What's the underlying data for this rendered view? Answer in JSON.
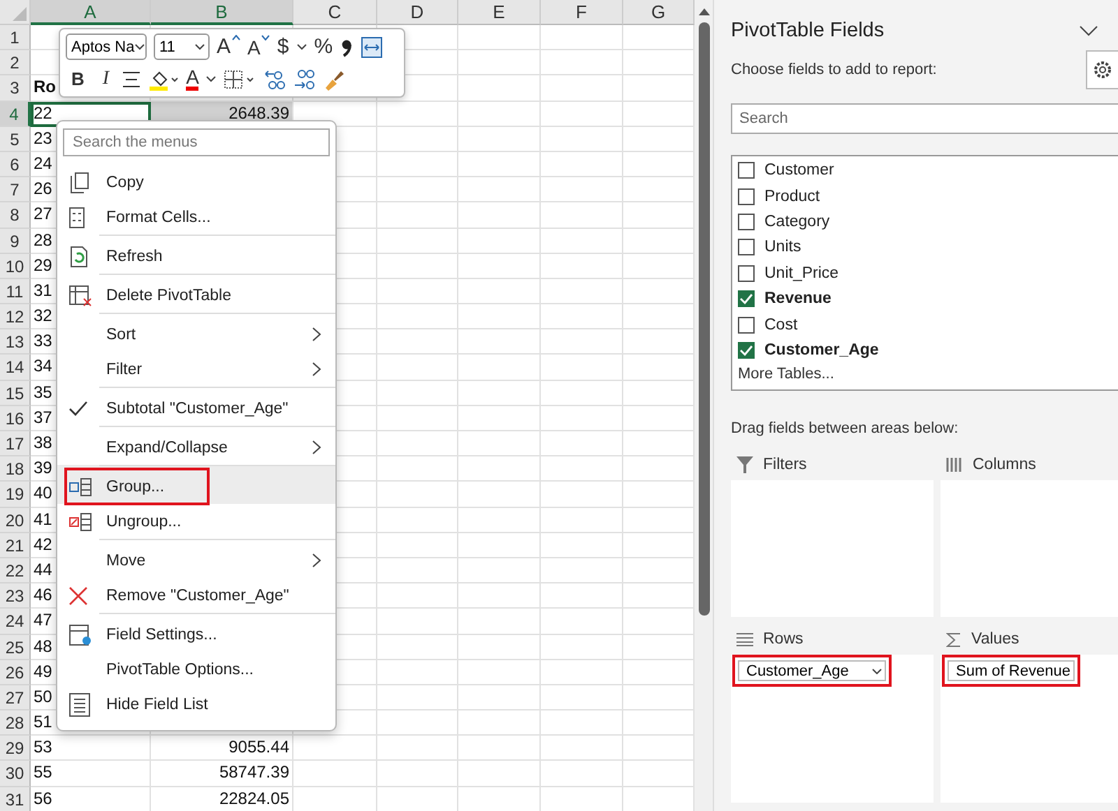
{
  "sheet": {
    "columns": [
      {
        "label": "A",
        "selected": true
      },
      {
        "label": "B",
        "selected": true
      },
      {
        "label": "C",
        "selected": false
      },
      {
        "label": "D",
        "selected": false
      },
      {
        "label": "E",
        "selected": false
      },
      {
        "label": "F",
        "selected": false
      },
      {
        "label": "G",
        "selected": false
      }
    ],
    "rows": [
      {
        "number": "1",
        "selected": false
      },
      {
        "number": "2",
        "selected": false
      },
      {
        "number": "3",
        "selected": false,
        "a": "Ro",
        "header": true
      },
      {
        "number": "4",
        "selected": true,
        "a": "22",
        "b": "2648.39"
      },
      {
        "number": "5",
        "selected": false,
        "a": "23"
      },
      {
        "number": "6",
        "selected": false,
        "a": "24"
      },
      {
        "number": "7",
        "selected": false,
        "a": "26"
      },
      {
        "number": "8",
        "selected": false,
        "a": "27"
      },
      {
        "number": "9",
        "selected": false,
        "a": "28"
      },
      {
        "number": "10",
        "selected": false,
        "a": "29"
      },
      {
        "number": "11",
        "selected": false,
        "a": "31"
      },
      {
        "number": "12",
        "selected": false,
        "a": "32"
      },
      {
        "number": "13",
        "selected": false,
        "a": "33"
      },
      {
        "number": "14",
        "selected": false,
        "a": "34"
      },
      {
        "number": "15",
        "selected": false,
        "a": "35"
      },
      {
        "number": "16",
        "selected": false,
        "a": "37"
      },
      {
        "number": "17",
        "selected": false,
        "a": "38"
      },
      {
        "number": "18",
        "selected": false,
        "a": "39"
      },
      {
        "number": "19",
        "selected": false,
        "a": "40"
      },
      {
        "number": "20",
        "selected": false,
        "a": "41"
      },
      {
        "number": "21",
        "selected": false,
        "a": "42"
      },
      {
        "number": "22",
        "selected": false,
        "a": "44"
      },
      {
        "number": "23",
        "selected": false,
        "a": "46"
      },
      {
        "number": "24",
        "selected": false,
        "a": "47"
      },
      {
        "number": "25",
        "selected": false,
        "a": "48"
      },
      {
        "number": "26",
        "selected": false,
        "a": "49"
      },
      {
        "number": "27",
        "selected": false,
        "a": "50"
      },
      {
        "number": "28",
        "selected": false,
        "a": "51"
      },
      {
        "number": "29",
        "selected": false,
        "a": "53",
        "b": "9055.44"
      },
      {
        "number": "30",
        "selected": false,
        "a": "55",
        "b": "58747.39"
      },
      {
        "number": "31",
        "selected": false,
        "a": "56",
        "b": "22824.05"
      }
    ]
  },
  "mini_toolbar": {
    "font_name": "Aptos Na",
    "font_size": "11",
    "row_1": [
      {
        "kind": "grow",
        "label": "A"
      },
      {
        "kind": "shrink",
        "label": "A"
      },
      {
        "kind": "currency",
        "label": "$"
      },
      {
        "kind": "percent",
        "label": "%"
      },
      {
        "kind": "comma"
      },
      {
        "kind": "wrap"
      }
    ],
    "row_2": [
      {
        "kind": "bold",
        "label": "B"
      },
      {
        "kind": "italic",
        "label": "I"
      },
      {
        "kind": "align"
      },
      {
        "kind": "fill"
      },
      {
        "kind": "font-color",
        "label": "A"
      },
      {
        "kind": "borders"
      },
      {
        "kind": "decrease-decimal"
      },
      {
        "kind": "increase-decimal"
      },
      {
        "kind": "format-painter"
      }
    ]
  },
  "context_menu": {
    "search": {
      "placeholder": "Search the menus"
    },
    "items": [
      {
        "label": "Copy",
        "checked": false,
        "submenu": false,
        "selected": false,
        "outlined": false,
        "separator_before": false
      },
      {
        "label": "Format Cells...",
        "checked": false,
        "submenu": false,
        "selected": false,
        "outlined": false,
        "separator_before": false
      },
      {
        "label": "Refresh",
        "checked": false,
        "submenu": false,
        "selected": false,
        "outlined": false,
        "separator_before": true
      },
      {
        "label": "Delete PivotTable",
        "checked": false,
        "submenu": false,
        "selected": false,
        "outlined": false,
        "separator_before": true
      },
      {
        "label": "Sort",
        "checked": false,
        "submenu": true,
        "selected": false,
        "outlined": false,
        "separator_before": true
      },
      {
        "label": "Filter",
        "checked": false,
        "submenu": true,
        "selected": false,
        "outlined": false,
        "separator_before": false
      },
      {
        "label": "Subtotal \"Customer_Age\"",
        "checked": true,
        "submenu": false,
        "selected": false,
        "outlined": false,
        "separator_before": true
      },
      {
        "label": "Expand/Collapse",
        "checked": false,
        "submenu": true,
        "selected": false,
        "outlined": false,
        "separator_before": true
      },
      {
        "label": "Group...",
        "checked": false,
        "submenu": false,
        "selected": true,
        "outlined": true,
        "separator_before": true
      },
      {
        "label": "Ungroup...",
        "checked": false,
        "submenu": false,
        "selected": false,
        "outlined": false,
        "separator_before": false
      },
      {
        "label": "Move",
        "checked": false,
        "submenu": true,
        "selected": false,
        "outlined": false,
        "separator_before": true
      },
      {
        "label": "Remove \"Customer_Age\"",
        "checked": false,
        "submenu": false,
        "selected": false,
        "outlined": false,
        "separator_before": false
      },
      {
        "label": "Field Settings...",
        "checked": false,
        "submenu": false,
        "selected": false,
        "outlined": false,
        "separator_before": true
      },
      {
        "label": "PivotTable Options...",
        "checked": false,
        "submenu": false,
        "selected": false,
        "outlined": false,
        "separator_before": false
      },
      {
        "label": "Hide Field List",
        "checked": false,
        "submenu": false,
        "selected": false,
        "outlined": false,
        "separator_before": false
      }
    ]
  },
  "pivot_pane": {
    "title": "PivotTable Fields",
    "subtitle": "Choose fields to add to report:",
    "search": {
      "placeholder": "Search"
    },
    "fields": [
      {
        "label": "Customer",
        "checked": false
      },
      {
        "label": "Product",
        "checked": false
      },
      {
        "label": "Category",
        "checked": false
      },
      {
        "label": "Units",
        "checked": false
      },
      {
        "label": "Unit_Price",
        "checked": false
      },
      {
        "label": "Revenue",
        "checked": true
      },
      {
        "label": "Cost",
        "checked": false
      },
      {
        "label": "Customer_Age",
        "checked": true
      }
    ],
    "more_tables": "More Tables...",
    "areas_hint": "Drag fields between areas below:",
    "areas": [
      {
        "kind": "filters",
        "label": "Filters"
      },
      {
        "kind": "columns",
        "label": "Columns"
      },
      {
        "kind": "rows",
        "label": "Rows",
        "field": {
          "label": "Customer_Age",
          "dropdown": true,
          "outlined": true
        }
      },
      {
        "kind": "values",
        "label": "Values",
        "field": {
          "label": "Sum of Revenue",
          "dropdown": false,
          "outlined": true
        }
      }
    ]
  }
}
